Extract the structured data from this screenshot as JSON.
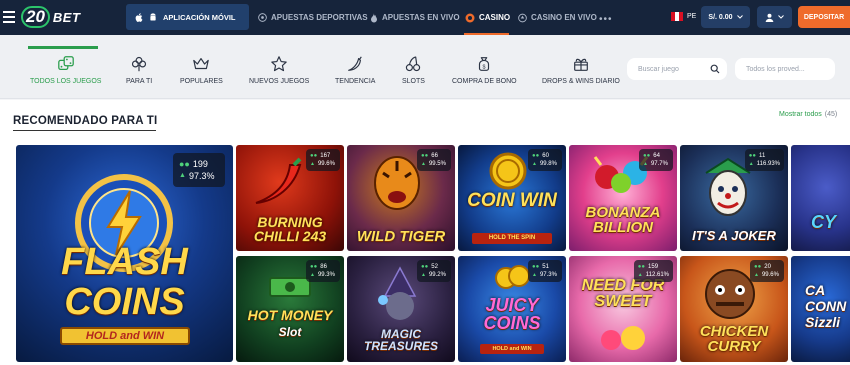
{
  "header": {
    "logo_number": "20",
    "logo_text": "BET",
    "app_button": "APLICACIÓN MÓVIL",
    "nav": [
      {
        "label": "APUESTAS DEPORTIVAS",
        "icon": "soccer-ball-icon"
      },
      {
        "label": "APUESTAS EN VIVO",
        "icon": "flame-icon"
      },
      {
        "label": "CASINO",
        "icon": "casino-chip-icon"
      },
      {
        "label": "CASINO EN VIVO",
        "icon": "spade-icon"
      }
    ],
    "more": "•••",
    "country": "PE",
    "balance": "S/. 0.00",
    "deposit": "DEPOSITAR"
  },
  "categories": [
    {
      "label": "TODOS LOS JUEGOS",
      "icon": "dice-icon"
    },
    {
      "label": "PARA TI",
      "icon": "clover-icon"
    },
    {
      "label": "POPULARES",
      "icon": "crown-icon"
    },
    {
      "label": "NUEVOS JUEGOS",
      "icon": "star-icon"
    },
    {
      "label": "TENDENCIA",
      "icon": "chili-icon"
    },
    {
      "label": "SLOTS",
      "icon": "cherries-icon"
    },
    {
      "label": "COMPRA DE BONO",
      "icon": "bonus-bag-icon"
    },
    {
      "label": "DROPS & WINS DIARIO",
      "icon": "gift-icon"
    }
  ],
  "search": {
    "placeholder": "Buscar juego"
  },
  "provider": {
    "placeholder": "Todos los proved..."
  },
  "section": {
    "title": "RECOMENDADO PARA TI",
    "show_all": "Mostrar todos",
    "count": "(45)"
  },
  "featured": {
    "title_line1": "FLASH",
    "title_line2": "COINS",
    "subtitle": "HOLD and WIN",
    "players": "199",
    "rtp": "97.3%"
  },
  "games": [
    {
      "title": "BURNING CHILLI 243",
      "players": "167",
      "rtp": "99.6%"
    },
    {
      "title": "WILD TIGER",
      "players": "66",
      "rtp": "99.5%"
    },
    {
      "title": "COIN WIN",
      "subtitle": "HOLD THE SPIN",
      "players": "60",
      "rtp": "99.8%"
    },
    {
      "title": "BONANZA BILLION",
      "players": "64",
      "rtp": "97.7%"
    },
    {
      "title": "IT'S A JOKER",
      "players": "11",
      "rtp": "116.93%"
    },
    {
      "title": "CY",
      "players": "",
      "rtp": ""
    },
    {
      "title": "HOT MONEY",
      "subtitle": "Slot",
      "players": "86",
      "rtp": "99.3%"
    },
    {
      "title": "MAGIC TREASURES",
      "players": "52",
      "rtp": "99.2%"
    },
    {
      "title": "JUICY COINS",
      "subtitle": "HOLD and WIN",
      "players": "51",
      "rtp": "97.3%"
    },
    {
      "title": "NEED FOR SWEET",
      "players": "159",
      "rtp": "112.61%"
    },
    {
      "title": "CHICKEN CURRY",
      "players": "20",
      "rtp": "99.6%"
    },
    {
      "title": "CA CONN Sizzli",
      "players": "",
      "rtp": ""
    }
  ],
  "colors": {
    "nav_bg": "#16243b",
    "accent_green": "#2a9d4c",
    "deposit_orange": "#ef6b2b"
  }
}
